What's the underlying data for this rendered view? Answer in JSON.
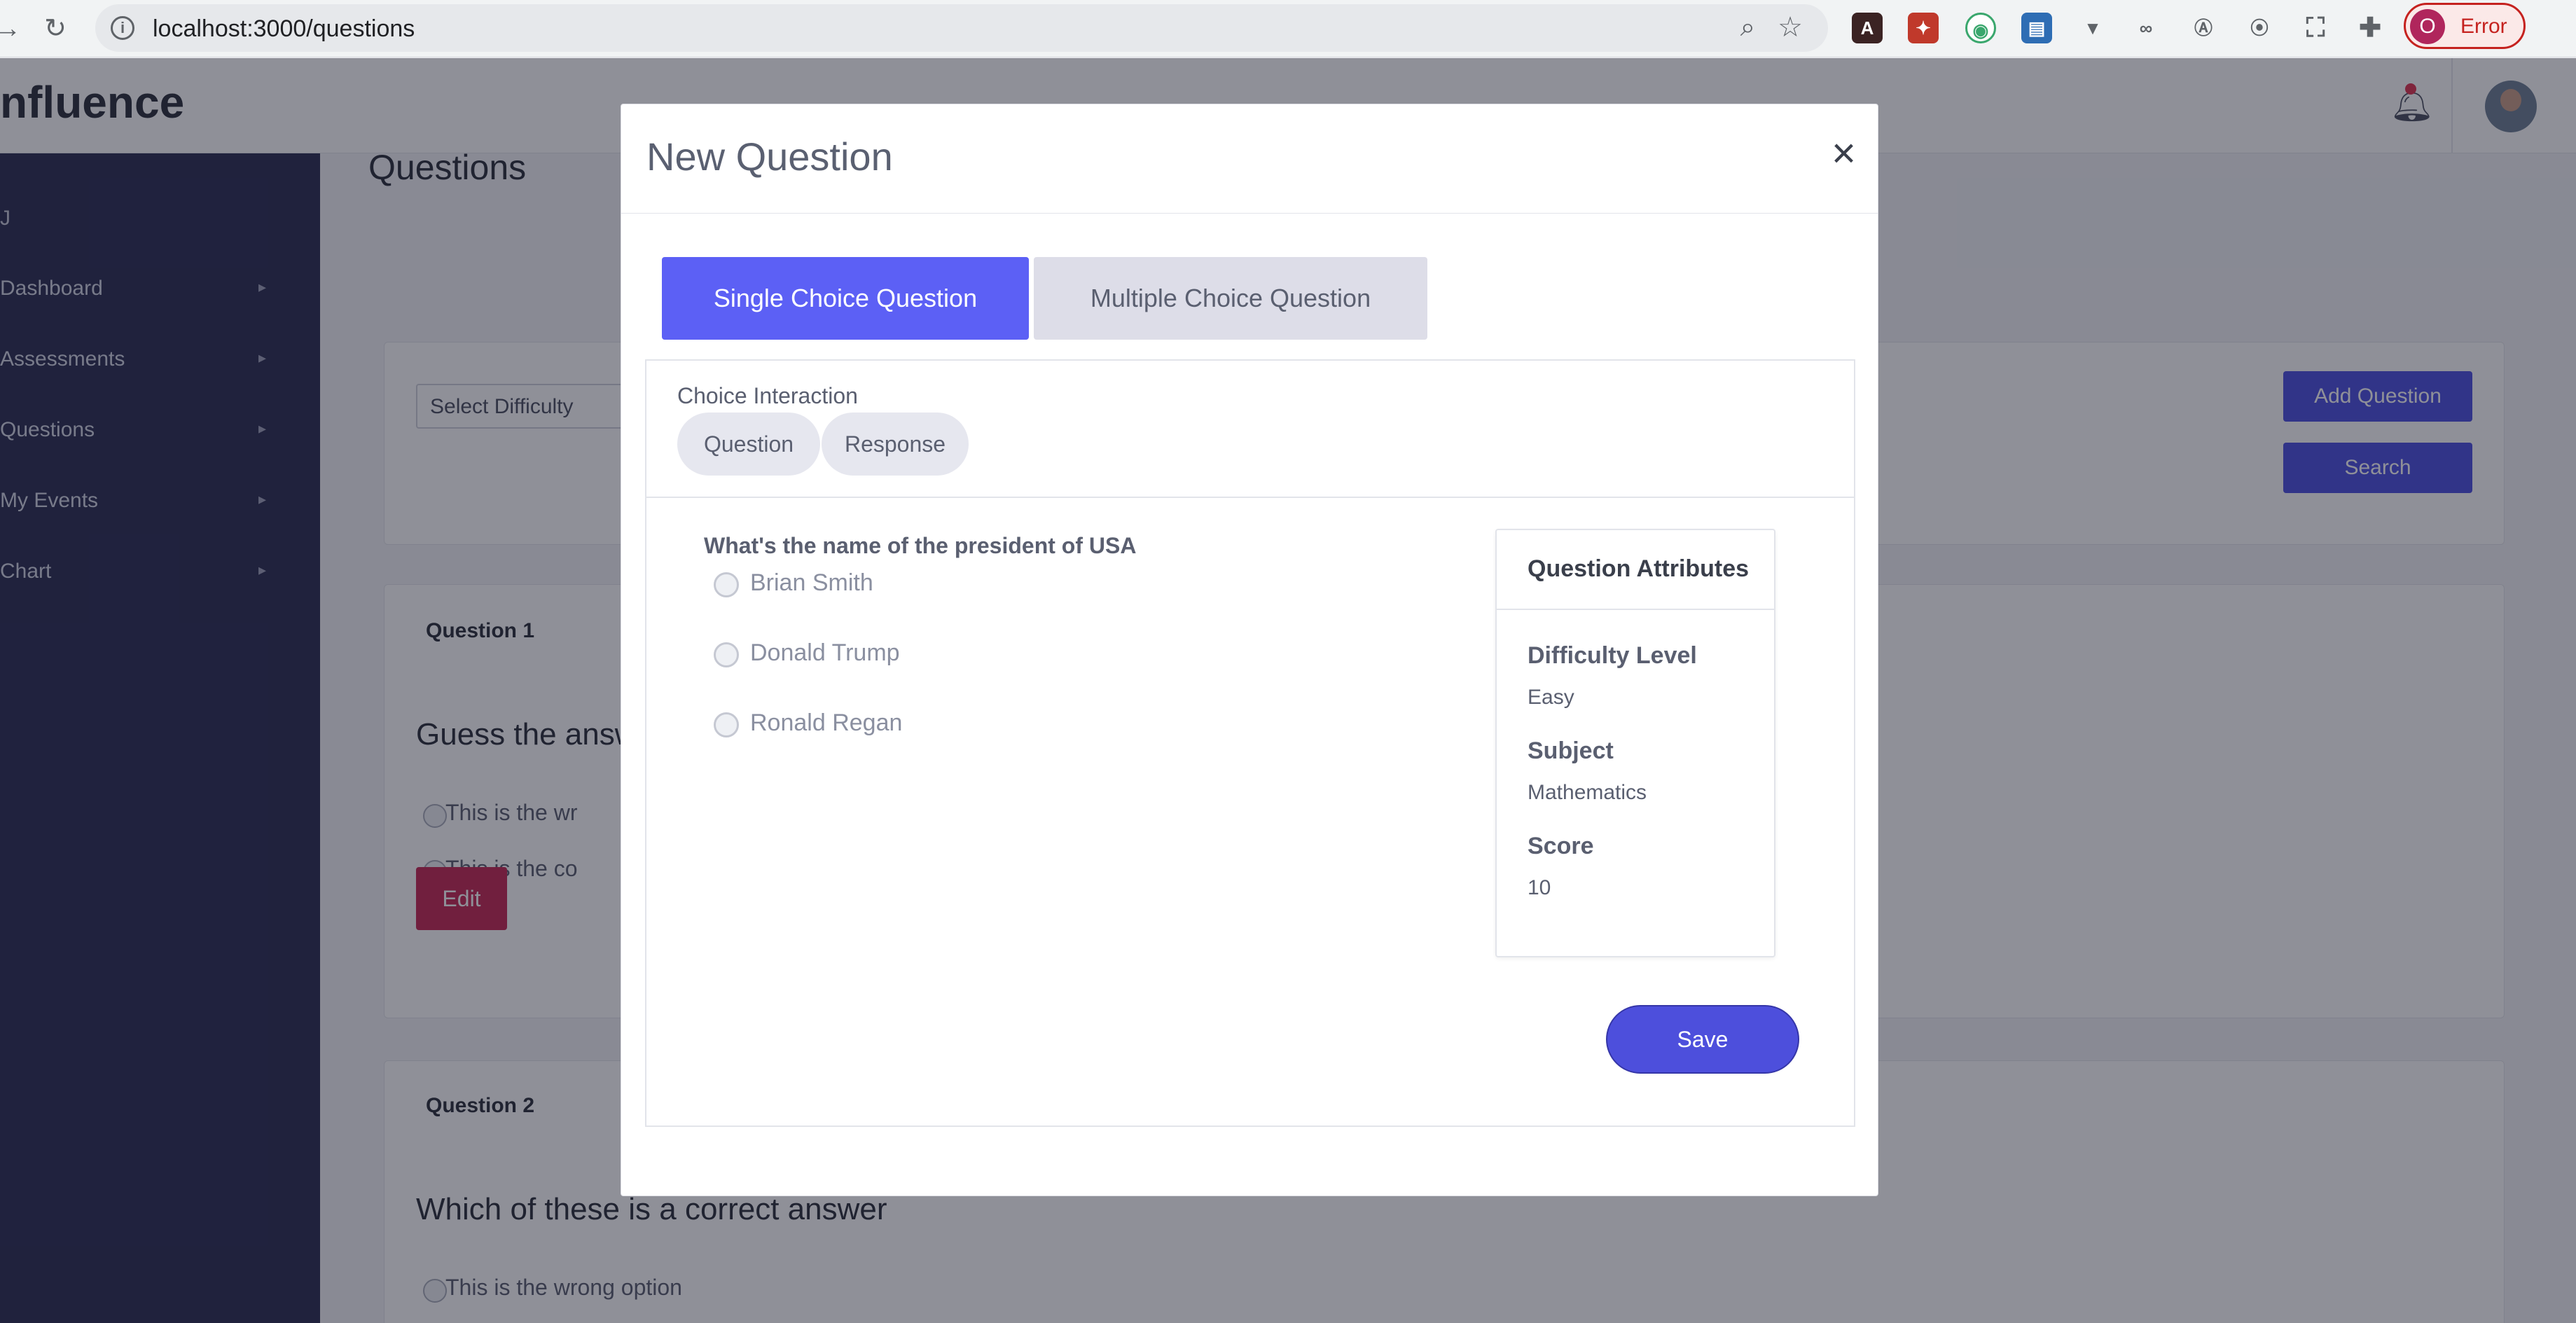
{
  "browser": {
    "url": "localhost:3000/questions",
    "profile_initial": "O",
    "profile_status": "Error"
  },
  "app": {
    "brand": "nfluence",
    "sidebar": {
      "header": "J",
      "items": [
        {
          "label": "Dashboard"
        },
        {
          "label": "Assessments"
        },
        {
          "label": "Questions"
        },
        {
          "label": "My Events"
        },
        {
          "label": "Chart"
        }
      ]
    },
    "page_title": "Questions",
    "filter_placeholder": "Select Difficulty",
    "add_question_label": "Add Question",
    "search_label": "Search",
    "questions": [
      {
        "label": "Question 1",
        "text": "Guess the answ",
        "options": [
          "This is the wr",
          "This is the co"
        ],
        "edit_label": "Edit"
      },
      {
        "label": "Question 2",
        "text": "Which of these is a correct answer",
        "options": [
          "This is the wrong option"
        ]
      }
    ]
  },
  "modal": {
    "title": "New Question",
    "close_symbol": "×",
    "tabs": [
      {
        "label": "Single Choice Question",
        "active": true
      },
      {
        "label": "Multiple Choice Question",
        "active": false
      }
    ],
    "interaction_label": "Choice Interaction",
    "subtabs": [
      "Question",
      "Response"
    ],
    "prompt": "What's the name of the president of USA",
    "choices": [
      "Brian Smith",
      "Donald Trump",
      "Ronald Regan"
    ],
    "attributes": {
      "title": "Question Attributes",
      "difficulty_label": "Difficulty Level",
      "difficulty_value": "Easy",
      "subject_label": "Subject",
      "subject_value": "Mathematics",
      "score_label": "Score",
      "score_value": "10"
    },
    "save_label": "Save"
  },
  "colors": {
    "accent": "#5c60f5",
    "sidebar": "#2b2d52",
    "edit": "#c62853",
    "error": "#c5221f"
  }
}
